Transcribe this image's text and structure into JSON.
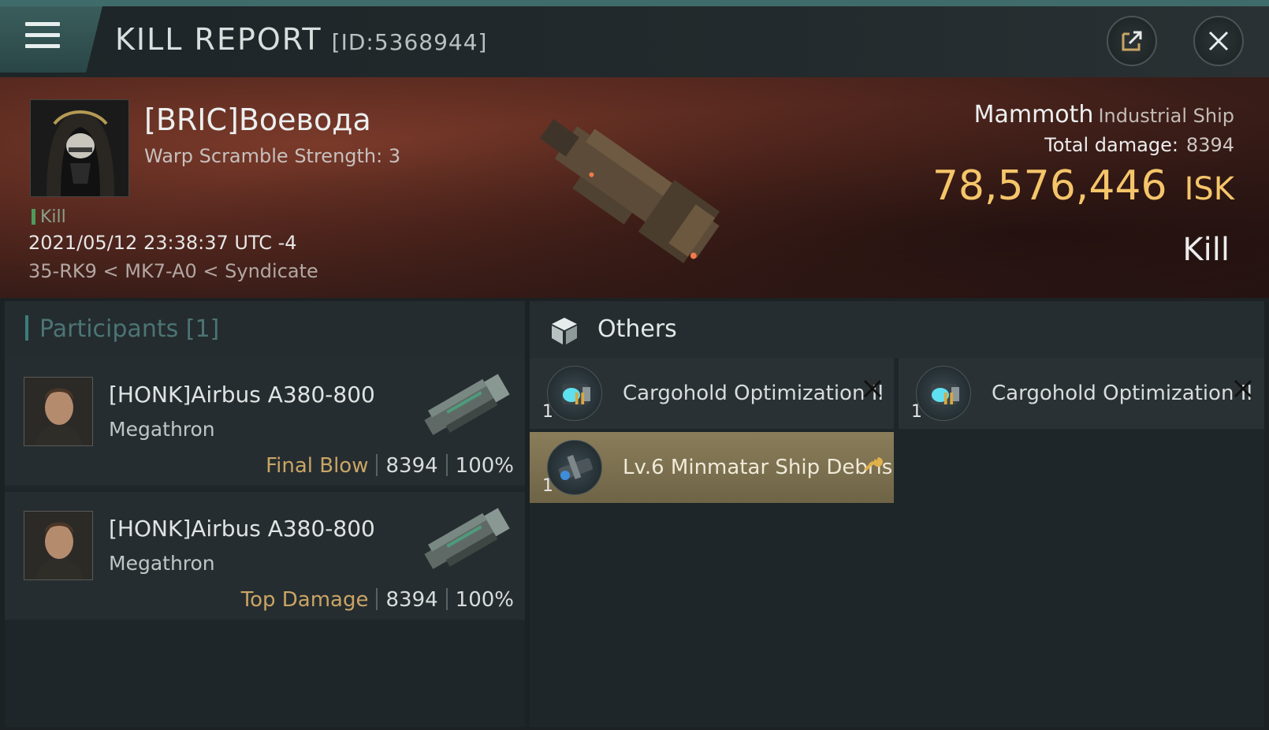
{
  "header": {
    "title": "KILL REPORT",
    "report_id": "[ID:5368944]",
    "menu_icon": "hamburger-menu-icon",
    "share_icon": "share-icon",
    "close_icon": "close-icon"
  },
  "victim": {
    "pilot_name": "[BRIC]Воевода",
    "warp_scramble": "Warp Scramble Strength: 3",
    "kill_tag": "Kill",
    "datetime": "2021/05/12 23:38:37 UTC -4",
    "location": "35-RK9 < MK7-A0 < Syndicate",
    "ship_name": "Mammoth",
    "ship_class": "Industrial Ship",
    "total_damage_label": "Total damage:",
    "total_damage": "8394",
    "isk_value": "78,576,446",
    "isk_unit": "ISK",
    "result": "Kill"
  },
  "participants": {
    "title": "Participants [1]",
    "items": [
      {
        "name": "[HONK]Airbus A380-800",
        "ship": "Megathron",
        "role": "Final Blow",
        "damage": "8394",
        "percent": "100%"
      },
      {
        "name": "[HONK]Airbus A380-800",
        "ship": "Megathron",
        "role": "Top Damage",
        "damage": "8394",
        "percent": "100%"
      }
    ]
  },
  "others": {
    "title": "Others",
    "items": [
      {
        "name": "Cargohold Optimization II",
        "qty": "1",
        "tech": "II",
        "status": "destroyed"
      },
      {
        "name": "Cargohold Optimization II",
        "qty": "1",
        "tech": "II",
        "status": "destroyed"
      },
      {
        "name": "Lv.6 Minmatar Ship Debris",
        "qty": "1",
        "status": "dropped"
      }
    ]
  },
  "colors": {
    "accent_teal": "#3f6c6a",
    "isk_gold": "#f5c56a",
    "role_gold": "#c9a565",
    "highlight_item": "#8a7d5a"
  }
}
